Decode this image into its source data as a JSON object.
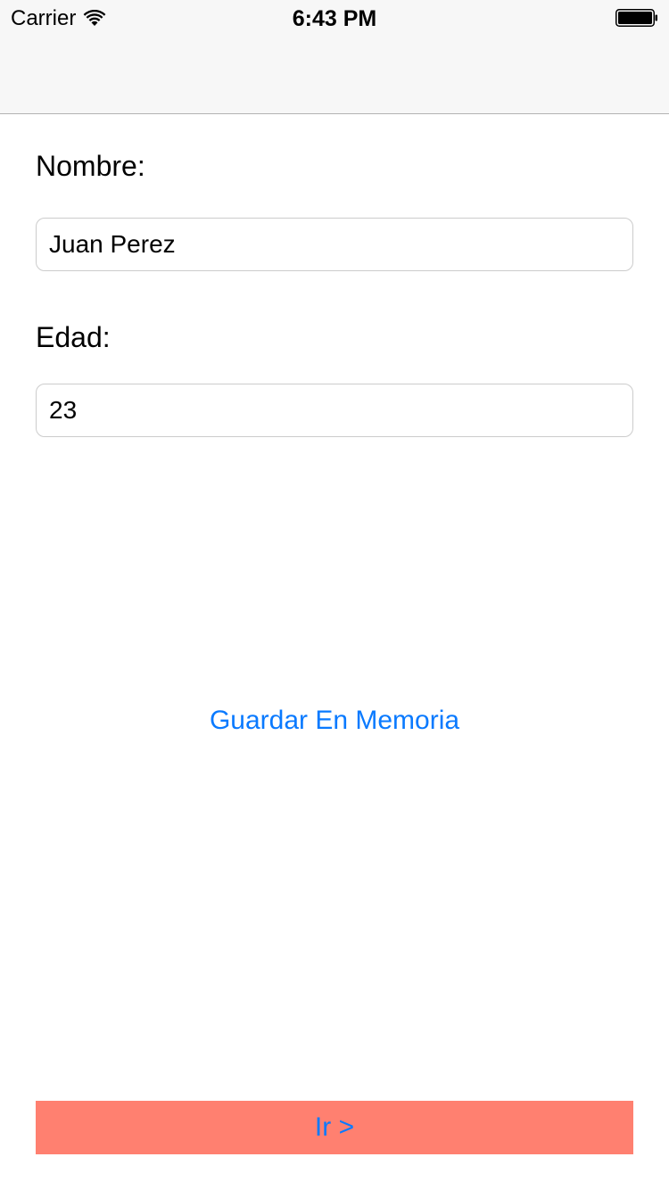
{
  "status_bar": {
    "carrier": "Carrier",
    "time": "6:43 PM",
    "wifi_icon": "wifi-icon",
    "battery_icon": "battery-icon"
  },
  "form": {
    "name_label": "Nombre:",
    "name_value": "Juan Perez",
    "age_label": "Edad:",
    "age_value": "23"
  },
  "actions": {
    "save_label": "Guardar En Memoria",
    "go_label": "Ir >"
  },
  "colors": {
    "tint": "#0a7aff",
    "go_button_background": "#ff8070",
    "nav_background": "#f7f7f7"
  }
}
